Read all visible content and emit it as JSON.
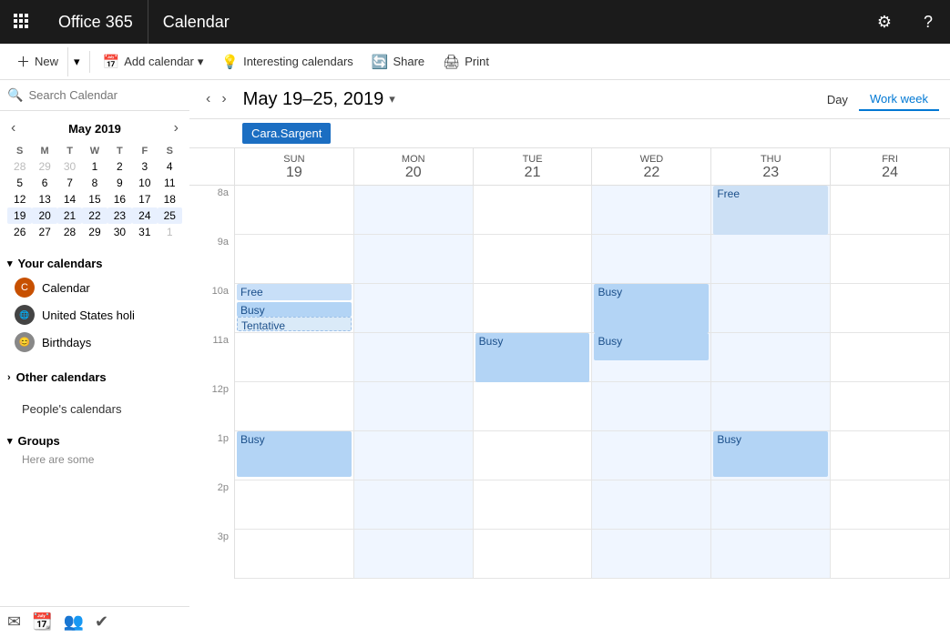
{
  "topbar": {
    "app_title": "Office 365",
    "module": "Calendar",
    "settings_label": "Settings",
    "help_label": "Help"
  },
  "toolbar": {
    "new_label": "New",
    "add_calendar_label": "Add calendar",
    "interesting_calendars_label": "Interesting calendars",
    "share_label": "Share",
    "print_label": "Print"
  },
  "sidebar": {
    "search_placeholder": "Search Calendar",
    "mini_cal": {
      "title": "May 2019",
      "days_of_week": [
        "S",
        "M",
        "T",
        "W",
        "T",
        "F",
        "S"
      ],
      "weeks": [
        [
          {
            "day": 28,
            "other": true
          },
          {
            "day": 29,
            "other": true
          },
          {
            "day": 30,
            "other": true
          },
          {
            "day": 1
          },
          {
            "day": 2
          },
          {
            "day": 3
          },
          {
            "day": 4
          }
        ],
        [
          {
            "day": 5
          },
          {
            "day": 6
          },
          {
            "day": 7
          },
          {
            "day": 8
          },
          {
            "day": 9
          },
          {
            "day": 10
          },
          {
            "day": 11
          }
        ],
        [
          {
            "day": 12
          },
          {
            "day": 13
          },
          {
            "day": 14
          },
          {
            "day": 15
          },
          {
            "day": 16
          },
          {
            "day": 17
          },
          {
            "day": 18
          }
        ],
        [
          {
            "day": 19,
            "selected": true
          },
          {
            "day": 20,
            "selected": true
          },
          {
            "day": 21,
            "selected": true
          },
          {
            "day": 22,
            "selected": true
          },
          {
            "day": 23,
            "selected": true
          },
          {
            "day": 24,
            "selected": true
          },
          {
            "day": 25,
            "selected": true
          }
        ],
        [
          {
            "day": 26
          },
          {
            "day": 27
          },
          {
            "day": 28
          },
          {
            "day": 29
          },
          {
            "day": 30
          },
          {
            "day": 31
          },
          {
            "day": 1,
            "other": true
          }
        ]
      ]
    },
    "your_calendars": {
      "label": "Your calendars",
      "items": [
        {
          "name": "Calendar",
          "icon": "C",
          "color": "red"
        },
        {
          "name": "United States holi",
          "icon": "U",
          "color": "gray-dark"
        },
        {
          "name": "Birthdays",
          "icon": "B",
          "color": "gray"
        }
      ]
    },
    "other_calendars": {
      "label": "Other calendars"
    },
    "people_calendars": {
      "label": "People's calendars"
    },
    "groups": {
      "label": "Groups",
      "sub": "Here are some"
    }
  },
  "cal_nav": {
    "date_range": "May 19–25, 2019",
    "view_day": "Day",
    "view_work_week": "Work week"
  },
  "people_bar": {
    "name": "Cara.Sargent"
  },
  "day_headers": [
    {
      "day_label": "19 Sunday",
      "day_num": "19",
      "day_name": "Sunday"
    },
    {
      "day_label": "20 Monday",
      "day_num": "20",
      "day_name": "Monday"
    },
    {
      "day_label": "21 Tuesday",
      "day_num": "21",
      "day_name": "Tuesday"
    },
    {
      "day_label": "22 Wednesday",
      "day_num": "22",
      "day_name": "Wednesday"
    },
    {
      "day_label": "23 Thursday",
      "day_num": "23",
      "day_name": "Thursday"
    },
    {
      "day_label": "24 Friday",
      "day_num": "24",
      "day_name": "Friday"
    }
  ],
  "time_slots": [
    "8a",
    "9a",
    "10a",
    "11a",
    "12p",
    "1p",
    "2p",
    "3p"
  ],
  "events": {
    "monday_free": {
      "label": "Free",
      "row": 3,
      "col": 2
    },
    "monday_busy": {
      "label": "Busy",
      "row": 3,
      "col": 2
    },
    "monday_tentative": {
      "label": "Tentative",
      "row": 3,
      "col": 2
    },
    "wednesday_busy_11": {
      "label": "Busy",
      "row": 4,
      "col": 4
    },
    "thursday_busy_10": {
      "label": "Busy",
      "row": 3,
      "col": 5
    },
    "thursday_busy_11": {
      "label": "Busy",
      "row": 4,
      "col": 5
    },
    "friday_free": {
      "label": "Free",
      "row": 1,
      "col": 6
    },
    "monday_busy_1p": {
      "label": "Busy",
      "row": 6,
      "col": 2
    },
    "friday_busy_1p": {
      "label": "Busy",
      "row": 6,
      "col": 6
    }
  }
}
